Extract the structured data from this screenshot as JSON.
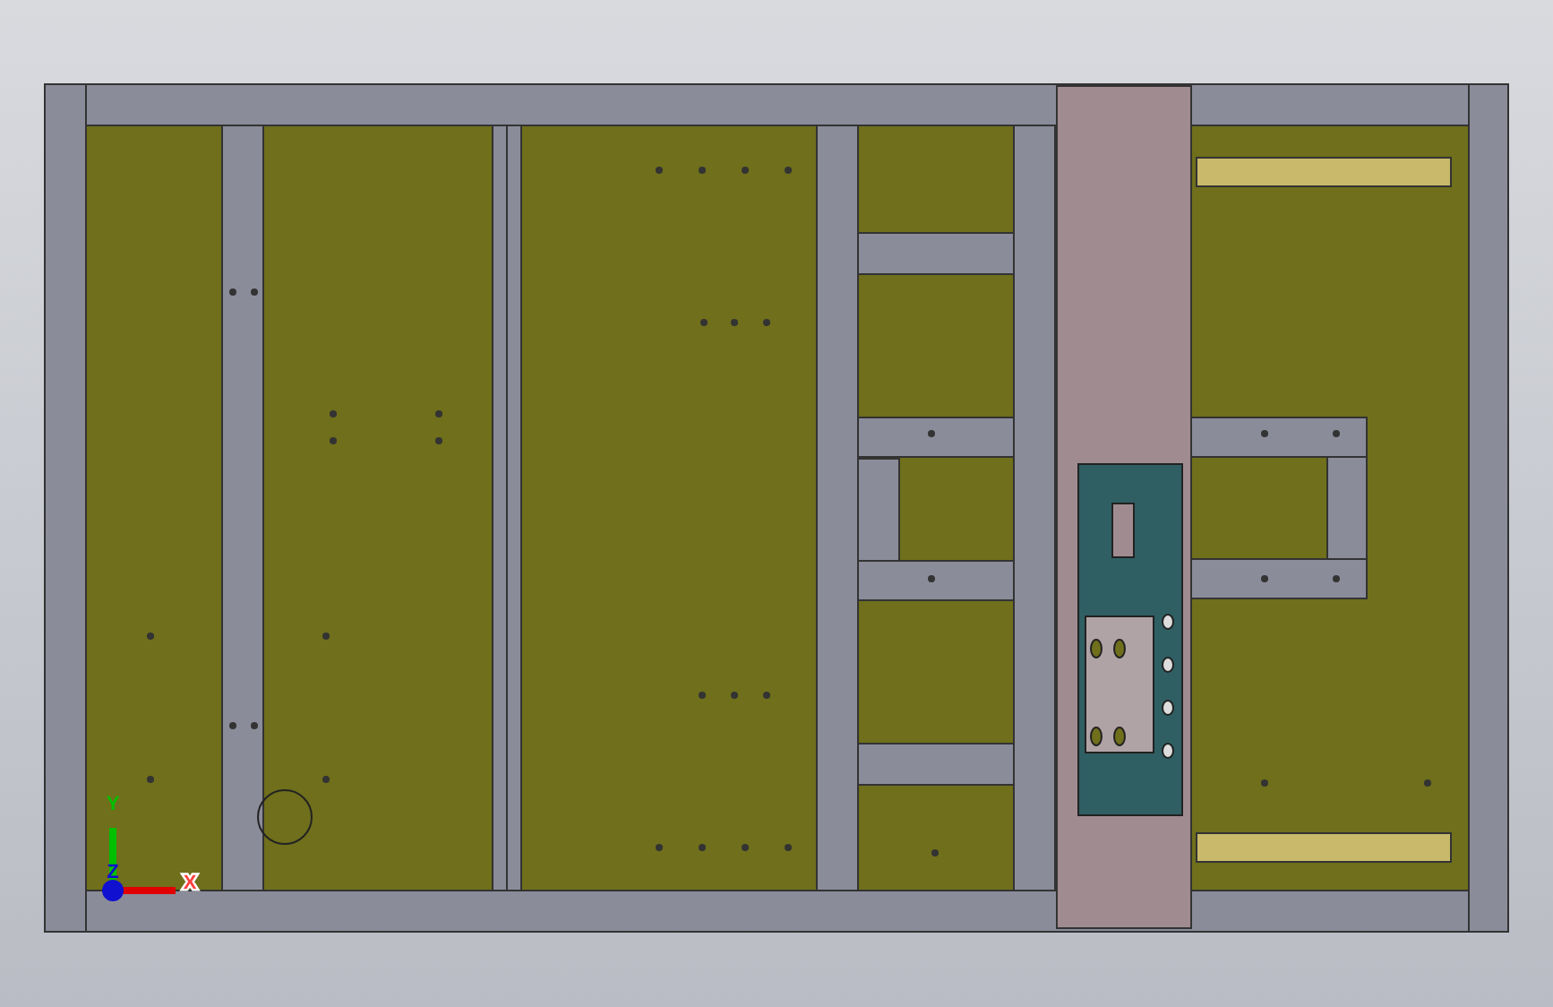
{
  "viewport": {
    "triad": {
      "axes": [
        {
          "kind": "y",
          "label": "Y"
        },
        {
          "kind": "x",
          "label": "X"
        },
        {
          "kind": "z",
          "label": "Z"
        }
      ]
    }
  }
}
